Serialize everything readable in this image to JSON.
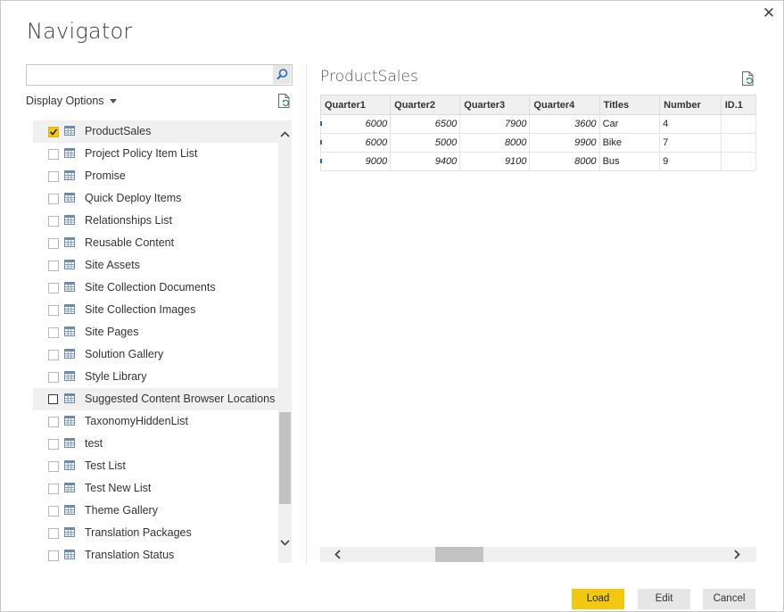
{
  "dialog": {
    "title": "Navigator",
    "close_glyph": "✕"
  },
  "search": {
    "placeholder": "",
    "value": ""
  },
  "display_options_label": "Display Options",
  "list": {
    "items": [
      {
        "label": "ProductSales",
        "checked": true
      },
      {
        "label": "Project Policy Item List",
        "checked": false
      },
      {
        "label": "Promise",
        "checked": false
      },
      {
        "label": "Quick Deploy Items",
        "checked": false
      },
      {
        "label": "Relationships List",
        "checked": false
      },
      {
        "label": "Reusable Content",
        "checked": false
      },
      {
        "label": "Site Assets",
        "checked": false
      },
      {
        "label": "Site Collection Documents",
        "checked": false
      },
      {
        "label": "Site Collection Images",
        "checked": false
      },
      {
        "label": "Site Pages",
        "checked": false
      },
      {
        "label": "Solution Gallery",
        "checked": false
      },
      {
        "label": "Style Library",
        "checked": false
      },
      {
        "label": "Suggested Content Browser Locations",
        "checked": false
      },
      {
        "label": "TaxonomyHiddenList",
        "checked": false
      },
      {
        "label": "test",
        "checked": false
      },
      {
        "label": "Test List",
        "checked": false
      },
      {
        "label": "Test New List",
        "checked": false
      },
      {
        "label": "Theme Gallery",
        "checked": false
      },
      {
        "label": "Translation Packages",
        "checked": false
      },
      {
        "label": "Translation Status",
        "checked": false
      }
    ],
    "selected_index": 0,
    "hovered_index": 12
  },
  "preview": {
    "title": "ProductSales",
    "columns": [
      "Quarter1",
      "Quarter2",
      "Quarter3",
      "Quarter4",
      "Titles",
      "Number",
      "ID.1"
    ],
    "rows": [
      [
        "6000",
        "6500",
        "7900",
        "3600",
        "Car",
        "4",
        ""
      ],
      [
        "6000",
        "5000",
        "8000",
        "9900",
        "Bike",
        "7",
        ""
      ],
      [
        "9000",
        "9400",
        "9100",
        "8000",
        "Bus",
        "9",
        ""
      ]
    ]
  },
  "buttons": {
    "load": "Load",
    "edit": "Edit",
    "cancel": "Cancel"
  },
  "colors": {
    "accent": "#f2c811",
    "row_marker": "#1e6fb8"
  }
}
